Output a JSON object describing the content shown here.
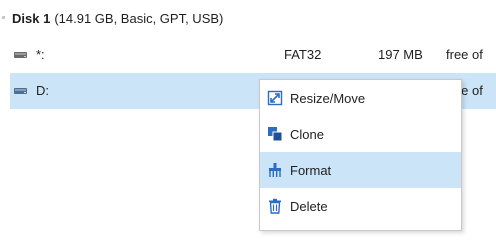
{
  "disk": {
    "title": "Disk 1",
    "info": "(14.91 GB, Basic, GPT, USB)"
  },
  "partitions": [
    {
      "label": "*:",
      "fs": "FAT32",
      "size": "197 MB",
      "free": "free of"
    },
    {
      "label": "D:",
      "fs": "",
      "size": "",
      "free": "free of"
    }
  ],
  "context_menu": {
    "items": [
      {
        "label": "Resize/Move",
        "icon": "resize-icon"
      },
      {
        "label": "Clone",
        "icon": "clone-icon"
      },
      {
        "label": "Format",
        "icon": "format-icon"
      },
      {
        "label": "Delete",
        "icon": "delete-icon"
      }
    ],
    "highlighted": "Format"
  },
  "colors": {
    "selection": "#cce4f7",
    "icon_blue": "#2b6cc4"
  }
}
